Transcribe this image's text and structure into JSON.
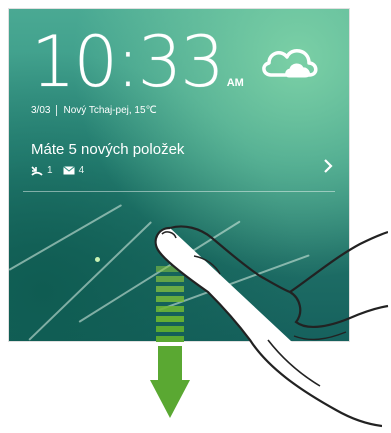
{
  "lockscreen": {
    "time": "10:33",
    "ampm": "AM",
    "date": "3/03",
    "location_weather": "Nový Tchaj-pej, 15℃",
    "weather_icon": "cloud-icon"
  },
  "notification": {
    "title": "Máte 5 nových položek",
    "missed_calls_icon": "missed-call-icon",
    "missed_calls_count": "1",
    "mail_icon": "mail-icon",
    "mail_count": "4",
    "expand_icon": "chevron-right-icon"
  },
  "gesture": {
    "direction": "swipe-down",
    "arrow_color": "#5aa832"
  }
}
